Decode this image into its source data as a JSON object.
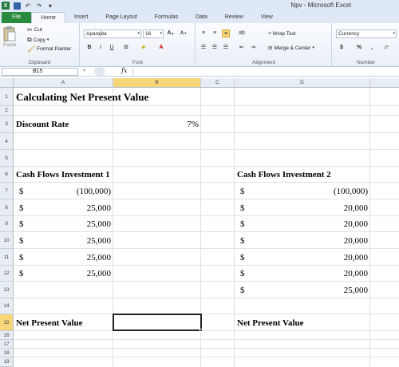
{
  "window": {
    "title": "Npv  -  Microsoft Excel"
  },
  "tabs": [
    "File",
    "Home",
    "Insert",
    "Page Layout",
    "Formulas",
    "Data",
    "Review",
    "View"
  ],
  "ribbon": {
    "clipboard": {
      "label": "Clipboard",
      "paste": "Paste",
      "cut": "Cut",
      "copy": "Copy",
      "format_painter": "Format Painter"
    },
    "font": {
      "label": "Font",
      "name": "Aparajita",
      "size": "16"
    },
    "alignment": {
      "label": "Alignment",
      "wrap_text": "Wrap Text",
      "merge_center": "Merge & Center"
    },
    "number": {
      "label": "Number",
      "format": "Currency",
      "currency_symbol": "$",
      "percent": "%",
      "comma": ","
    }
  },
  "formula_bar": {
    "name_box": "B15",
    "fx": "fx",
    "content": ""
  },
  "columns": [
    "A",
    "B",
    "C",
    "D"
  ],
  "rows": [
    "1",
    "2",
    "3",
    "4",
    "5",
    "6",
    "7",
    "8",
    "9",
    "10",
    "11",
    "12",
    "13",
    "14",
    "15",
    "16",
    "17",
    "18",
    "19"
  ],
  "active_cell": {
    "column": "B",
    "row": "15"
  },
  "cells": {
    "A1": "Calculating Net Present Value",
    "A3": "Discount Rate",
    "B3": "7%",
    "A6": "Cash Flows Investment 1",
    "D6": "Cash Flows Investment 2",
    "inv1_rows": [
      {
        "sym": "$",
        "val": "(100,000)"
      },
      {
        "sym": "$",
        "val": "25,000"
      },
      {
        "sym": "$",
        "val": "25,000"
      },
      {
        "sym": "$",
        "val": "25,000"
      },
      {
        "sym": "$",
        "val": "25,000"
      },
      {
        "sym": "$",
        "val": "25,000"
      }
    ],
    "inv2_rows": [
      {
        "sym": "$",
        "val": "(100,000)"
      },
      {
        "sym": "$",
        "val": "20,000"
      },
      {
        "sym": "$",
        "val": "20,000"
      },
      {
        "sym": "$",
        "val": "20,000"
      },
      {
        "sym": "$",
        "val": "20,000"
      },
      {
        "sym": "$",
        "val": "20,000"
      },
      {
        "sym": "$",
        "val": "25,000"
      }
    ],
    "A15": "Net Present Value",
    "D15": "Net Present Value"
  }
}
